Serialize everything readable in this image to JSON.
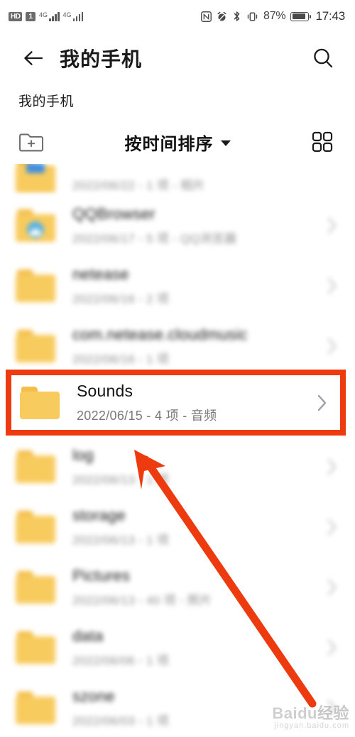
{
  "status_bar": {
    "hd_badge": "HD",
    "sim_badge": "1",
    "network_generation_1": "4G",
    "network_generation_2": "4G",
    "icons": [
      "nfc-icon",
      "alarm-muted-icon",
      "bluetooth-icon",
      "vibrate-icon"
    ],
    "battery_percent": "87%",
    "battery_level": 87,
    "clock": "17:43"
  },
  "appbar": {
    "back_icon": "back-arrow-icon",
    "title": "我的手机",
    "search_icon": "search-icon"
  },
  "breadcrumb": {
    "path": "我的手机"
  },
  "toolbar": {
    "new_folder_icon": "new-folder-icon",
    "sort_label": "按时间排序",
    "sort_caret": "chevron-down-icon",
    "grid_view_icon": "grid-view-icon"
  },
  "highlight": {
    "color": "#ED3A0E",
    "target_name": "Sounds",
    "arrow_color": "#ED3A0E"
  },
  "colors": {
    "folder_body": "#F8CB5E",
    "folder_tab": "#F3BE49",
    "accent_red": "#ED3A0E",
    "text_primary": "#1b1b1b",
    "text_secondary": "#8d8d8d"
  },
  "files": [
    {
      "name": "",
      "meta": "2022/06/22 - 1 项 - 相片",
      "icon": "folder-blue-badge-icon",
      "blurred": true,
      "partial": true,
      "highlighted": false
    },
    {
      "name": "QQBrowser",
      "meta": "2022/06/17 - 5 项 - QQ浏览器",
      "icon": "folder-blue-circle-icon",
      "blurred": true,
      "partial": false,
      "highlighted": false
    },
    {
      "name": "netease",
      "meta": "2022/06/16 - 2 项",
      "icon": "folder-icon",
      "blurred": true,
      "partial": false,
      "highlighted": false
    },
    {
      "name": "com.netease.cloudmusic",
      "meta": "2022/06/16 - 1 项",
      "icon": "folder-icon",
      "blurred": true,
      "partial": false,
      "highlighted": false
    },
    {
      "name": "Sounds",
      "meta": "2022/06/15 - 4 项 - 音频",
      "icon": "folder-icon",
      "blurred": false,
      "partial": false,
      "highlighted": true
    },
    {
      "name": "log",
      "meta": "2022/06/13 - 1 项",
      "icon": "folder-icon",
      "blurred": true,
      "partial": false,
      "highlighted": false
    },
    {
      "name": "storage",
      "meta": "2022/06/13 - 1 项",
      "icon": "folder-icon",
      "blurred": true,
      "partial": false,
      "highlighted": false
    },
    {
      "name": "Pictures",
      "meta": "2022/06/13 - 40 项 - 照片",
      "icon": "folder-icon",
      "blurred": true,
      "partial": false,
      "highlighted": false
    },
    {
      "name": "data",
      "meta": "2022/06/06 - 1 项",
      "icon": "folder-icon",
      "blurred": true,
      "partial": false,
      "highlighted": false
    },
    {
      "name": "szone",
      "meta": "2022/06/03 - 1 项",
      "icon": "folder-icon",
      "blurred": true,
      "partial": false,
      "highlighted": false
    }
  ],
  "watermark": {
    "brand": "Baidu",
    "brand_cn": "经验",
    "url": "jingyan.baidu.com"
  }
}
